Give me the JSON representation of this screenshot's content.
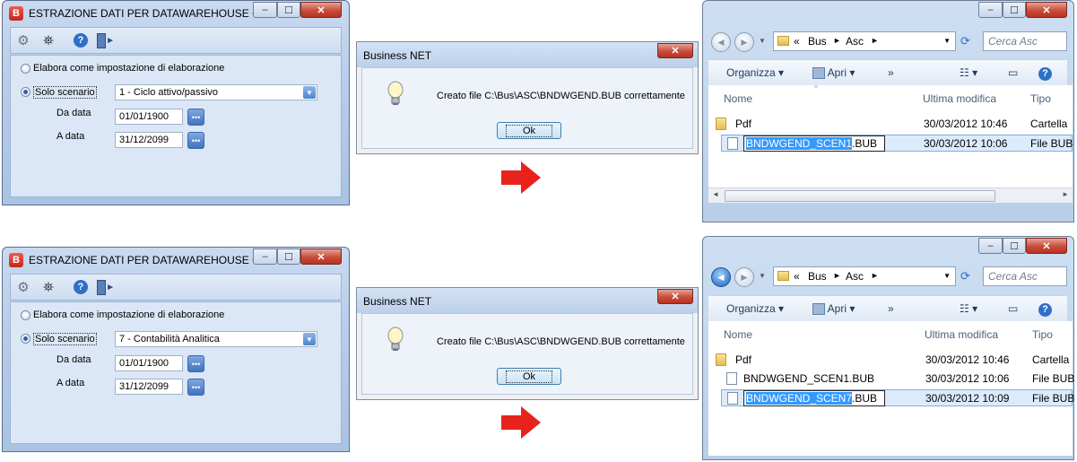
{
  "app_windows": [
    {
      "title": "ESTRAZIONE DATI PER DATAWAREHOUSE <...",
      "icon_letter": "B",
      "option1_label": "Elabora come impostazione di elaborazione",
      "option2_label": "Solo scenario",
      "scenario_value": "1 - Ciclo attivo/passivo",
      "da_data_label": "Da data",
      "da_data_value": "01/01/1900",
      "a_data_label": "A data",
      "a_data_value": "31/12/2099",
      "minimize": "–",
      "maximize": "☐",
      "close": "✕"
    },
    {
      "title": "ESTRAZIONE DATI PER DATAWAREHOUSE <...",
      "icon_letter": "B",
      "option1_label": "Elabora come impostazione di elaborazione",
      "option2_label": "Solo scenario",
      "scenario_value": "7 - Contabilità Analitica",
      "da_data_label": "Da data",
      "da_data_value": "01/01/1900",
      "a_data_label": "A data",
      "a_data_value": "31/12/2099",
      "minimize": "–",
      "maximize": "☐",
      "close": "✕"
    }
  ],
  "dialogs": [
    {
      "title": "Business NET",
      "message": "Creato file C:\\Bus\\ASC\\BNDWGEND.BUB correttamente",
      "ok_label": "Ok",
      "close": "✕"
    },
    {
      "title": "Business NET",
      "message": "Creato file C:\\Bus\\ASC\\BNDWGEND.BUB correttamente",
      "ok_label": "Ok",
      "close": "✕"
    }
  ],
  "explorers": [
    {
      "path_prefix": "«",
      "path1": "Bus",
      "path2": "Asc",
      "search_placeholder": "Cerca Asc",
      "organize": "Organizza",
      "open": "Apri",
      "more": "»",
      "col_name": "Nome",
      "col_modified": "Ultima modifica",
      "col_type": "Tipo",
      "rows": [
        {
          "name": "Pdf",
          "date": "30/03/2012 10:46",
          "type": "Cartella"
        },
        {
          "name_sel": "BNDWGEND_SCEN1",
          "name_ext": ".BUB",
          "date": "30/03/2012 10:06",
          "type": "File BUB"
        }
      ],
      "minimize": "–",
      "maximize": "☐",
      "close": "✕"
    },
    {
      "path_prefix": "«",
      "path1": "Bus",
      "path2": "Asc",
      "search_placeholder": "Cerca Asc",
      "organize": "Organizza",
      "open": "Apri",
      "more": "»",
      "col_name": "Nome",
      "col_modified": "Ultima modifica",
      "col_type": "Tipo",
      "rows": [
        {
          "name": "Pdf",
          "date": "30/03/2012 10:46",
          "type": "Cartella"
        },
        {
          "name": "BNDWGEND_SCEN1.BUB",
          "date": "30/03/2012 10:06",
          "type": "File BUB"
        },
        {
          "name_sel": "BNDWGEND_SCEN7",
          "name_ext": ".BUB",
          "date": "30/03/2012 10:09",
          "type": "File BUB"
        }
      ],
      "minimize": "–",
      "maximize": "☐",
      "close": "✕"
    }
  ],
  "colors": {
    "arrow": "#e8231c",
    "selection": "#3399ff",
    "accent": "#2a62b8"
  }
}
